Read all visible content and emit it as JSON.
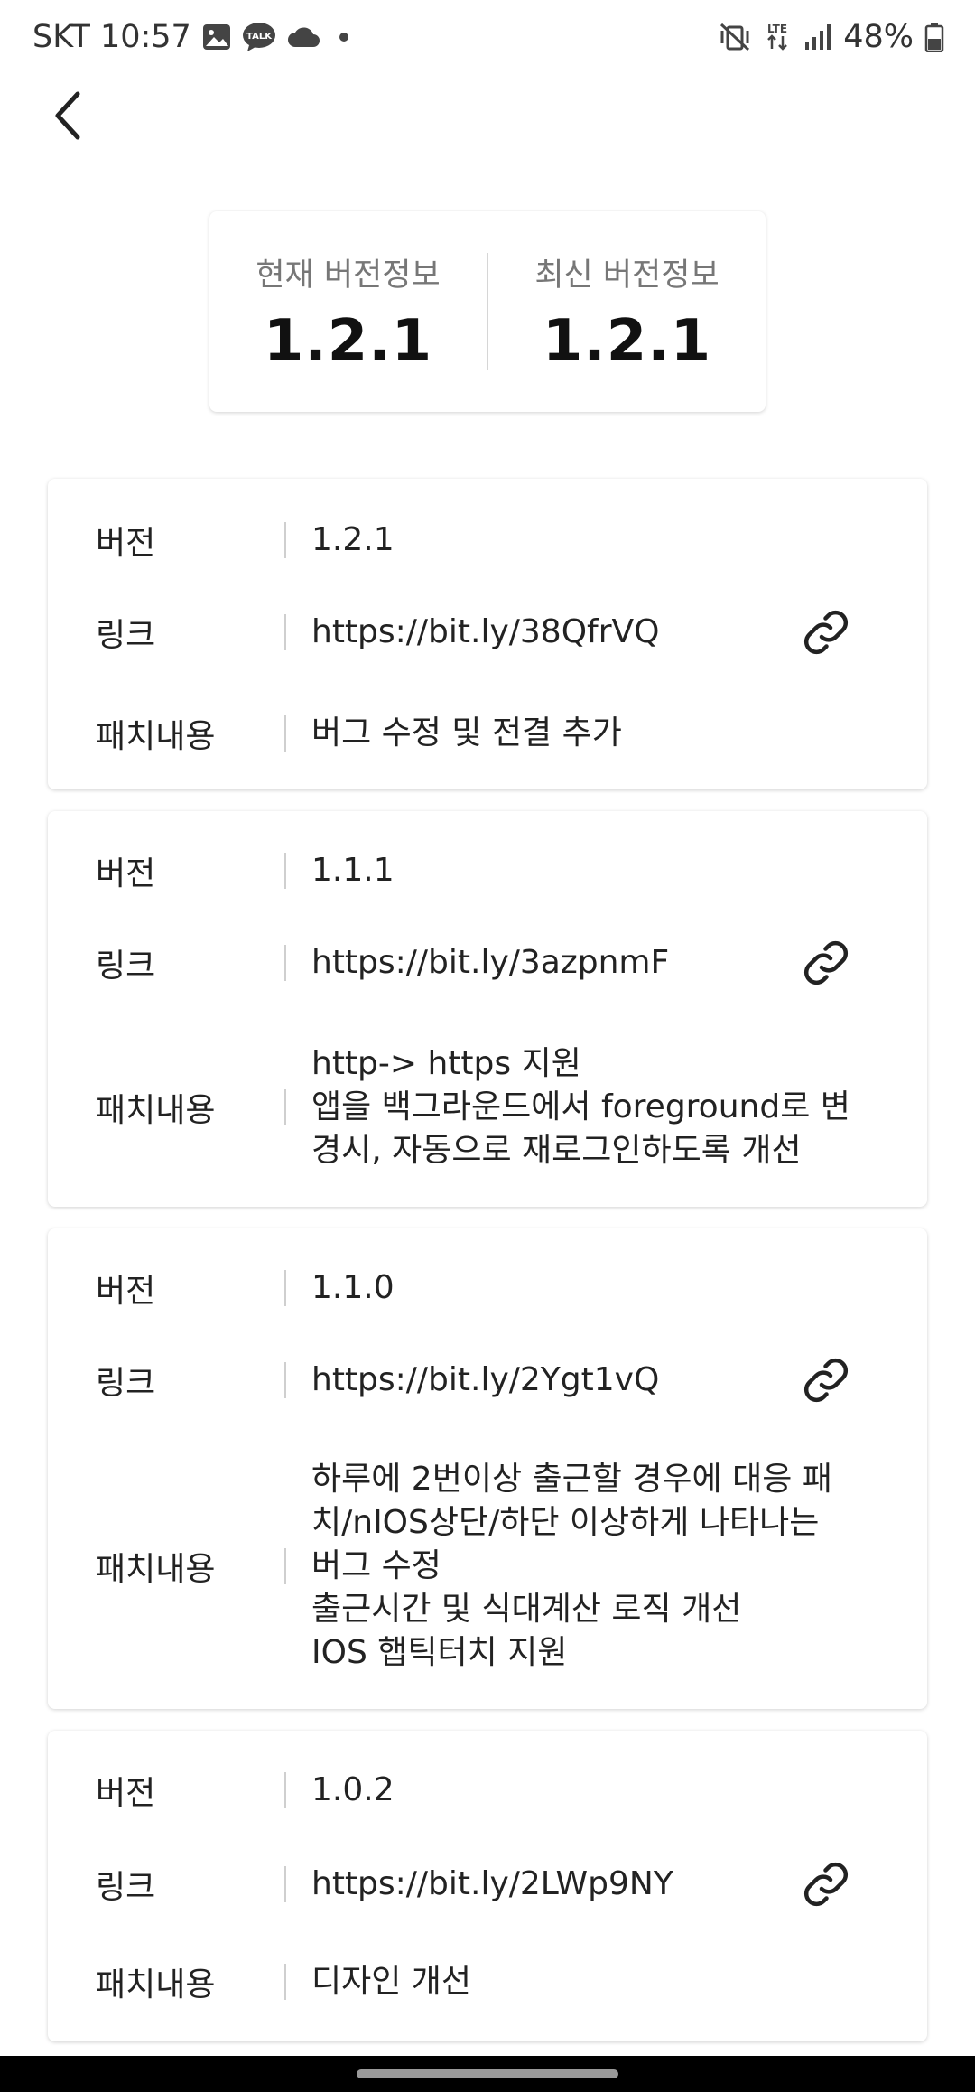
{
  "status_bar": {
    "carrier_time": "SKT 10:57",
    "battery": "48%",
    "network": "LTE",
    "icons_left": [
      "gallery-icon",
      "talk-icon",
      "cloud-icon"
    ],
    "icons_right": [
      "mute-vibrate-icon",
      "lte-icon",
      "signal-icon",
      "battery-icon"
    ]
  },
  "header": {
    "back_icon": "chevron-left-icon"
  },
  "summary": {
    "current_label": "현재 버전정보",
    "current_value": "1.2.1",
    "latest_label": "최신 버전정보",
    "latest_value": "1.2.1"
  },
  "labels": {
    "version": "버전",
    "link": "링크",
    "patch": "패치내용"
  },
  "versions": [
    {
      "version": "1.2.1",
      "link": "https://bit.ly/38QfrVQ",
      "patch": [
        "버그 수정 및 전결 추가"
      ]
    },
    {
      "version": "1.1.1",
      "link": "https://bit.ly/3azpnmF",
      "patch": [
        "http-> https 지원",
        "앱을 백그라운드에서 foreground로 변",
        "경시, 자동으로 재로그인하도록 개선"
      ]
    },
    {
      "version": "1.1.0",
      "link": "https://bit.ly/2Ygt1vQ",
      "patch": [
        "하루에 2번이상 출근할 경우에 대응 패",
        "치/nIOS상단/하단 이상하게 나타나는",
        "버그 수정",
        "출근시간 및 식대계산 로직 개선",
        "IOS 햅틱터치 지원"
      ]
    },
    {
      "version": "1.0.2",
      "link": "https://bit.ly/2LWp9NY",
      "patch": [
        "디자인 개선"
      ]
    }
  ]
}
